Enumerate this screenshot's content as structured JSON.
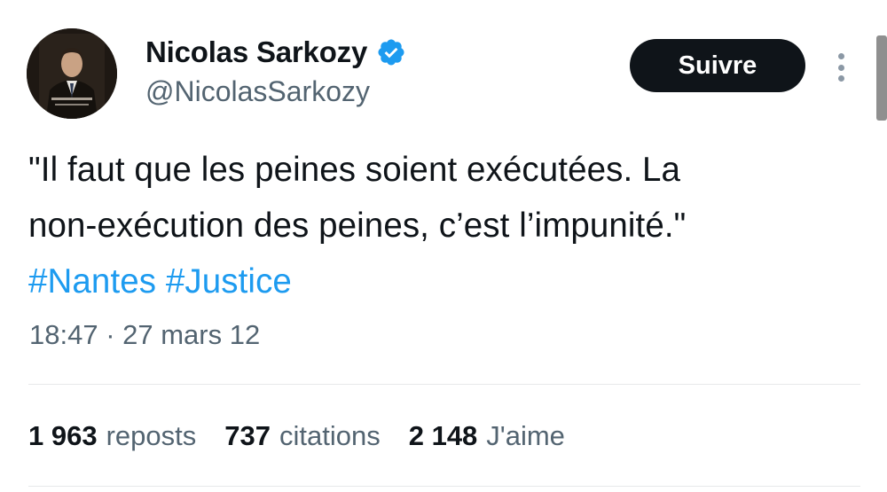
{
  "author": {
    "display_name": "Nicolas Sarkozy",
    "handle": "@NicolasSarkozy",
    "verified": true,
    "avatar_text": "NICOLAS SARKOZY"
  },
  "actions": {
    "follow_label": "Suivre"
  },
  "tweet": {
    "text_lines": [
      "\"Il faut que les peines soient exécutées. La",
      "non-exécution des peines, c’est l’impunité.\""
    ],
    "hashtags": [
      "#Nantes",
      "#Justice"
    ],
    "timestamp": "18:47 · 27 mars 12"
  },
  "stats": [
    {
      "value": "1 963",
      "label": "reposts"
    },
    {
      "value": "737",
      "label": "citations"
    },
    {
      "value": "2 148",
      "label": "J'aime"
    }
  ],
  "colors": {
    "text": "#0f1419",
    "muted": "#536471",
    "link": "#1d9bf0",
    "verified": "#1d9bf0",
    "button_bg": "#0f1419",
    "divider": "#e7e9ea"
  }
}
